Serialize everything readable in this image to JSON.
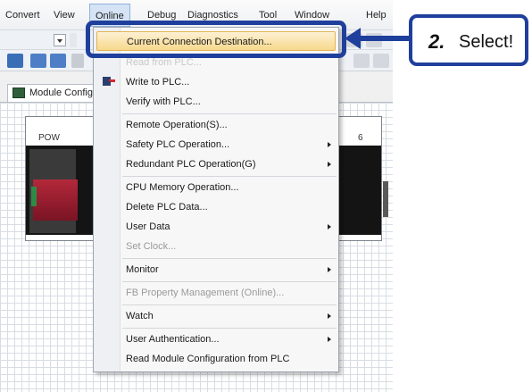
{
  "menubar": {
    "items": [
      "Convert",
      "View",
      "Online",
      "Debug",
      "Diagnostics",
      "Tool",
      "Window",
      "Help"
    ]
  },
  "tab": {
    "label": "Module Configuration"
  },
  "rack": {
    "slot_label_pow": "POW",
    "slot_label_6": "6"
  },
  "dropdown": {
    "items": [
      {
        "label": "Current Connection Destination...",
        "highlight": true
      },
      {
        "label": "Read from PLC..."
      },
      {
        "label": "Write to PLC..."
      },
      {
        "label": "Verify with PLC..."
      },
      {
        "label": "Remote Operation(S)..."
      },
      {
        "label": "Safety PLC Operation...",
        "submenu": true
      },
      {
        "label": "Redundant PLC Operation(G)",
        "submenu": true
      },
      {
        "label": "CPU Memory Operation..."
      },
      {
        "label": "Delete PLC Data..."
      },
      {
        "label": "User Data",
        "submenu": true
      },
      {
        "label": "Set Clock...",
        "disabled": true
      },
      {
        "label": "Monitor",
        "submenu": true
      },
      {
        "label": "FB Property Management (Online)...",
        "disabled": true
      },
      {
        "label": "Watch",
        "submenu": true
      },
      {
        "label": "User Authentication...",
        "submenu": true
      },
      {
        "label": "Read Module Configuration from PLC"
      }
    ]
  },
  "callout": {
    "step_number": "2.",
    "step_text": "Select!"
  },
  "colors": {
    "accent_frame": "#1f3f9c",
    "menu_highlight": "#f7d88b"
  }
}
